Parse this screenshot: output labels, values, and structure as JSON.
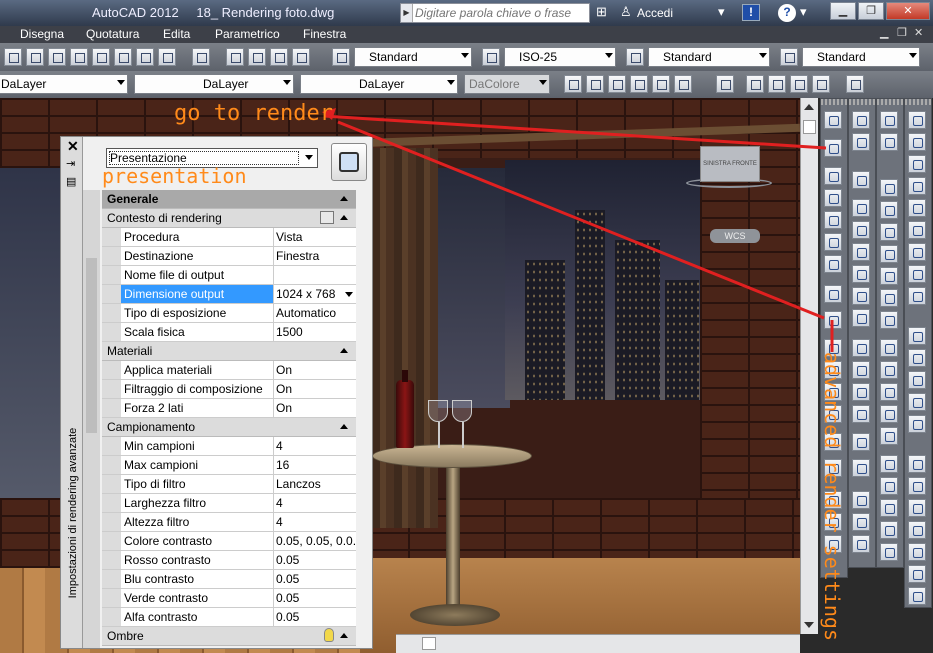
{
  "titlebar": {
    "app_title": "AutoCAD 2012",
    "file_name": "18_ Rendering foto.dwg",
    "search_placeholder": "Digitare parola chiave o frase",
    "login_label": "Accedi"
  },
  "menu": [
    "Disegna",
    "Quotatura",
    "Edita",
    "Parametrico",
    "Finestra"
  ],
  "toolbar1": {
    "text_style": "Standard",
    "dim_style": "ISO-25",
    "table_style": "Standard",
    "multileader_style": "Standard"
  },
  "toolbar2": {
    "layer": "DaLayer",
    "linetype": "DaLayer",
    "lineweight": "DaLayer",
    "plot_color": "DaColore"
  },
  "scene": {
    "viewcube_labels": "SINISTRA  FRONTE",
    "wcs_label": "WCS"
  },
  "palette": {
    "title": "Impostazioni di rendering avanzate",
    "preset": "Presentazione",
    "categories": [
      {
        "label": "Generale"
      },
      {
        "label": "Contesto di rendering"
      },
      {
        "label": "Materiali"
      },
      {
        "label": "Campionamento"
      },
      {
        "label": "Ombre"
      }
    ],
    "rows": [
      {
        "key": "Procedura",
        "value": "Vista"
      },
      {
        "key": "Destinazione",
        "value": "Finestra"
      },
      {
        "key": "Nome file di output",
        "value": ""
      },
      {
        "key": "Dimensione output",
        "value": "1024 x 768"
      },
      {
        "key": "Tipo di esposizione",
        "value": "Automatico"
      },
      {
        "key": "Scala fisica",
        "value": "1500"
      },
      {
        "key": "Applica materiali",
        "value": "On"
      },
      {
        "key": "Filtraggio di composizione",
        "value": "On"
      },
      {
        "key": "Forza 2 lati",
        "value": "On"
      },
      {
        "key": "Min campioni",
        "value": "4"
      },
      {
        "key": "Max campioni",
        "value": "16"
      },
      {
        "key": "Tipo di filtro",
        "value": "Lanczos"
      },
      {
        "key": "Larghezza filtro",
        "value": "4"
      },
      {
        "key": "Altezza filtro",
        "value": "4"
      },
      {
        "key": "Colore contrasto",
        "value": "0.05, 0.05, 0.0..."
      },
      {
        "key": "Rosso contrasto",
        "value": "0.05"
      },
      {
        "key": "Blu contrasto",
        "value": "0.05"
      },
      {
        "key": "Verde contrasto",
        "value": "0.05"
      },
      {
        "key": "Alfa contrasto",
        "value": "0.05"
      }
    ]
  },
  "annotations": {
    "go_to_render": "go to render",
    "presentation": "presentation",
    "advanced": "advanced render settings"
  },
  "colors": {
    "annotation": "#ff8a1a",
    "arrow": "#e02020",
    "selected_row": "#3399ff"
  }
}
